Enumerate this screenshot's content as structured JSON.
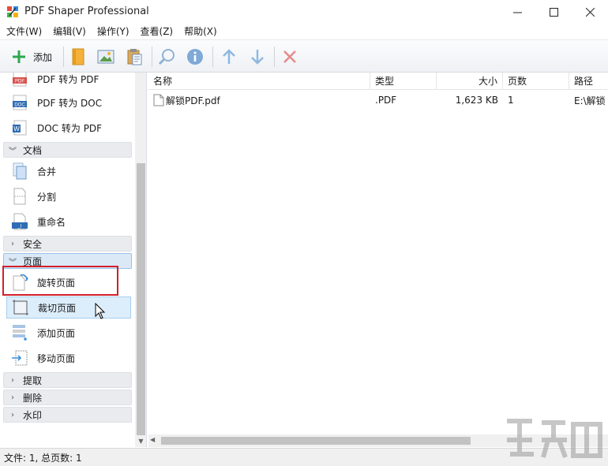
{
  "window": {
    "title": "PDF Shaper Professional",
    "minimize": "—",
    "maximize": "☐",
    "close": "✕"
  },
  "menu": [
    "文件(W)",
    "编辑(V)",
    "操作(Y)",
    "查看(Z)",
    "帮助(X)"
  ],
  "toolbar": {
    "add_label": "添加"
  },
  "sidebar": {
    "convert_items": [
      {
        "label": "PDF 转为 PDF",
        "icon": "pdf-to-pdf-icon"
      },
      {
        "label": "PDF 转为 DOC",
        "icon": "pdf-to-doc-icon"
      },
      {
        "label": "DOC 转为 PDF",
        "icon": "doc-to-pdf-icon"
      }
    ],
    "cat_document": "文档",
    "document_items": [
      {
        "label": "合并",
        "icon": "merge-icon"
      },
      {
        "label": "分割",
        "icon": "split-icon"
      },
      {
        "label": "重命名",
        "icon": "rename-icon"
      }
    ],
    "cat_security": "安全",
    "cat_pages": "页面",
    "page_items": [
      {
        "label": "旋转页面",
        "icon": "rotate-page-icon"
      },
      {
        "label": "裁切页面",
        "icon": "crop-page-icon"
      },
      {
        "label": "添加页面",
        "icon": "add-page-icon"
      },
      {
        "label": "移动页面",
        "icon": "move-page-icon"
      }
    ],
    "cat_extract": "提取",
    "cat_delete": "删除",
    "cat_watermark": "水印"
  },
  "file_list": {
    "columns": [
      "名称",
      "类型",
      "大小",
      "页数",
      "路径"
    ],
    "rows": [
      {
        "name": "解锁PDF.pdf",
        "type": ".PDF",
        "size": "1,623 KB",
        "pages": "1",
        "path": "E:\\解锁"
      }
    ]
  },
  "status": "文件: 1, 总页数: 1",
  "colors": {
    "accent_blue": "#3c8fd8",
    "highlight_red": "#d21f2a",
    "add_green": "#2ea84d"
  }
}
